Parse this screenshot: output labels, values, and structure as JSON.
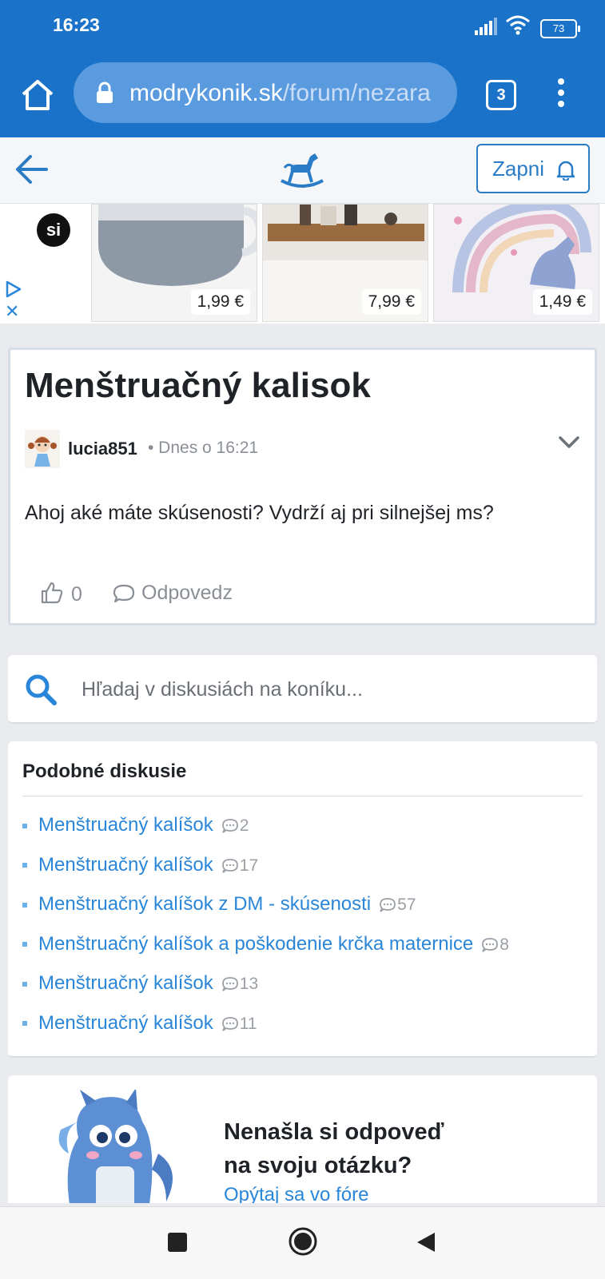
{
  "status_bar": {
    "time": "16:23",
    "battery": "73"
  },
  "browser": {
    "url_domain": "modrykonik.sk",
    "url_path": "/forum/nezara",
    "tab_count": "3"
  },
  "topnav": {
    "subscribe_label": "Zapni"
  },
  "ad": {
    "brand": "si",
    "close": "✕",
    "products": [
      {
        "price": "1,99 €"
      },
      {
        "price": "7,99 €"
      },
      {
        "price": "1,49 €"
      }
    ]
  },
  "post": {
    "title": "Menštruačný kalisok",
    "author": "lucia851",
    "time": "• Dnes o 16:21",
    "body": "Ahoj aké máte skúsenosti? Vydrží aj pri silnejšej ms?",
    "likes": "0",
    "reply_label": "Odpovedz"
  },
  "search": {
    "placeholder": "Hľadaj v diskusiách na koníku..."
  },
  "related": {
    "title": "Podobné diskusie",
    "items": [
      {
        "title": "Menštruačný kalíšok",
        "count": "2"
      },
      {
        "title": "Menštruačný kalíšok",
        "count": "17"
      },
      {
        "title": "Menštruačný kalíšok z DM - skúsenosti",
        "count": "57"
      },
      {
        "title": "Menštruačný kalíšok a poškodenie krčka maternice",
        "count": "8"
      },
      {
        "title": "Menštruačný kalíšok",
        "count": "13"
      },
      {
        "title": "Menštruačný kalíšok",
        "count": "11"
      }
    ]
  },
  "promo": {
    "title_line1": "Nenašla si odpoveď",
    "title_line2": "na svoju otázku?",
    "link": "Opýtaj sa vo fóre"
  },
  "colors": {
    "brand_blue": "#1a73c9",
    "link_blue": "#2a86d8"
  }
}
